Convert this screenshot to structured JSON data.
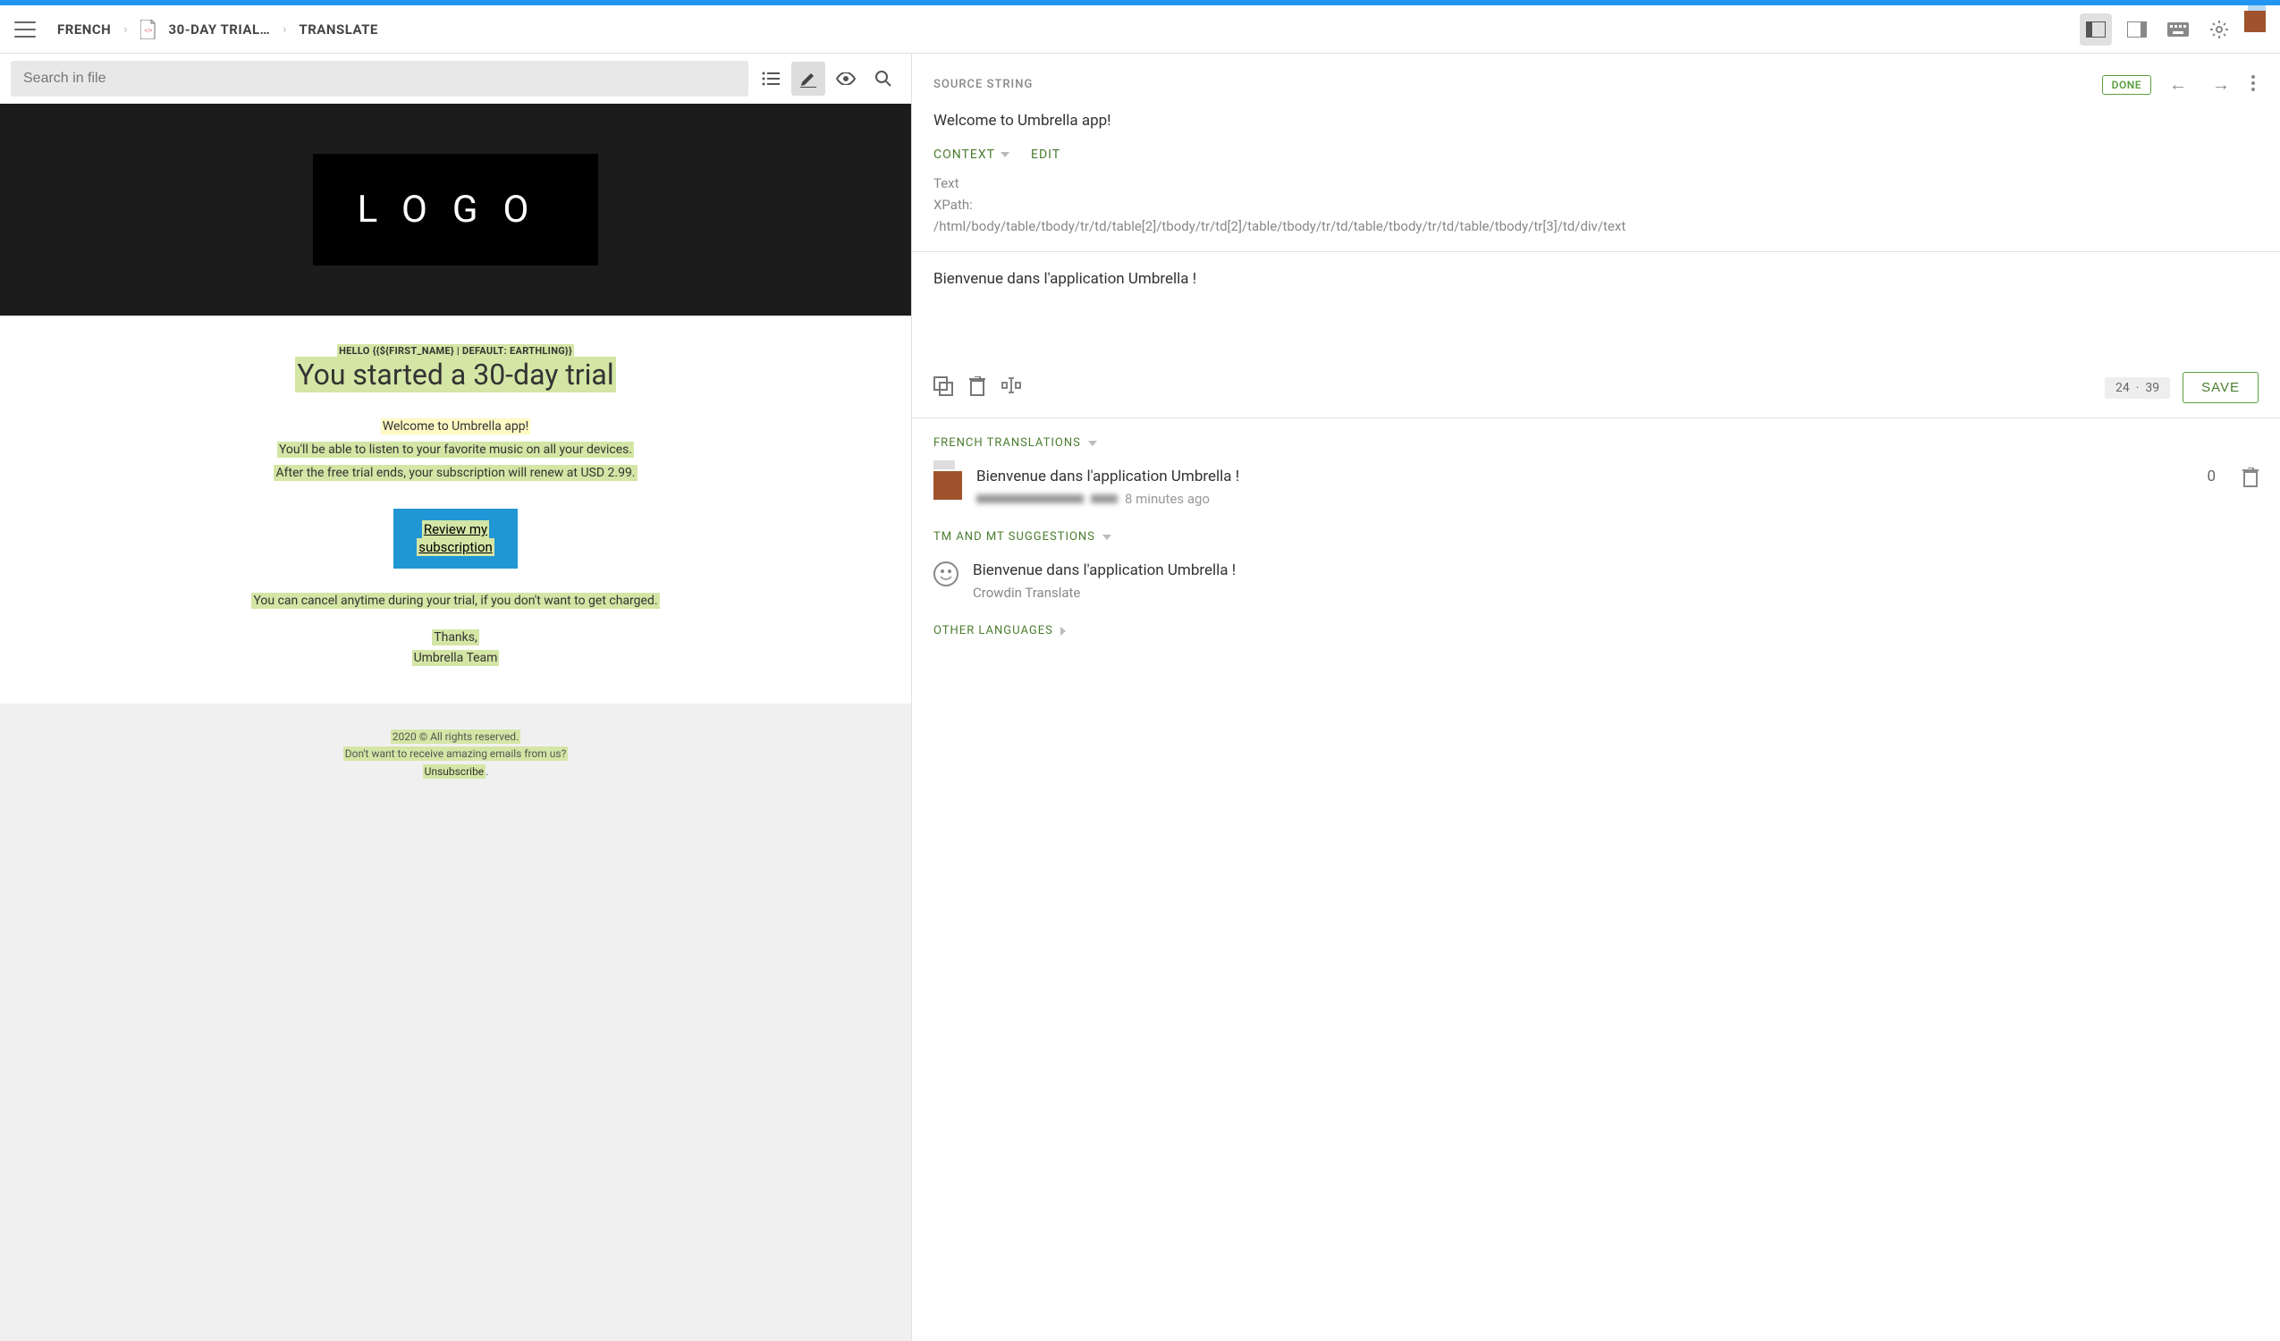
{
  "header": {
    "breadcrumb": [
      "FRENCH",
      "30-DAY TRIAL…",
      "TRANSLATE"
    ]
  },
  "search": {
    "placeholder": "Search in file"
  },
  "preview": {
    "logo": "LOGO",
    "greeting": "HELLO {{${FIRST_NAME} | DEFAULT: EARTHLING}}",
    "title": "You started a 30-day trial",
    "welcome": "Welcome to Umbrella app!",
    "line2": "You'll be able to listen to your favorite music on all your devices.",
    "line3": "After the free trial ends, your subscription will renew at USD 2.99.",
    "cta1": "Review my",
    "cta2": "subscription",
    "cancel_note": "You can cancel anytime during your trial, if you don't want to get charged.",
    "thanks": "Thanks,",
    "team": "Umbrella Team",
    "copyright": "2020 © All rights reserved.",
    "unsubscribe_q": "Don't want to receive amazing emails from us?",
    "unsubscribe": "Unsubscribe"
  },
  "source": {
    "label": "SOURCE STRING",
    "done": "DONE",
    "text": "Welcome to Umbrella app!",
    "context_label": "CONTEXT",
    "edit_label": "EDIT",
    "text_label": "Text",
    "xpath_label": "XPath:",
    "xpath": "/html/body/table/tbody/tr/td/table[2]/tbody/tr/td[2]/table/tbody/tr/td/table/tbody/tr/td/table/tbody/tr[3]/td/div/text"
  },
  "translation": {
    "value": "Bienvenue dans l'application Umbrella !",
    "count1": "24",
    "count2": "39",
    "save": "SAVE"
  },
  "sections": {
    "french": "FRENCH TRANSLATIONS",
    "tm": "TM AND MT SUGGESTIONS",
    "other": "OTHER LANGUAGES"
  },
  "french_trans": {
    "text": "Bienvenue dans l'application Umbrella !",
    "time": "8 minutes ago",
    "votes": "0"
  },
  "mt": {
    "text": "Bienvenue dans l'application Umbrella !",
    "source": "Crowdin Translate"
  }
}
